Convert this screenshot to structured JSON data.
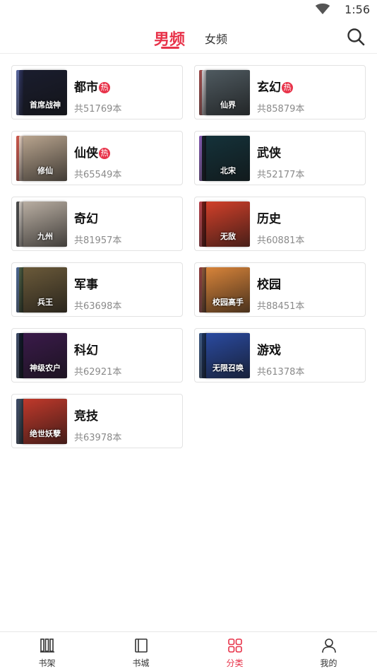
{
  "status_bar": {
    "time": "1:56",
    "wifi_icon": "wifi-icon"
  },
  "tabs": {
    "male": "男频",
    "female": "女频",
    "search_icon": "search-icon"
  },
  "hot_badge": "热",
  "categories": [
    {
      "name": "都市",
      "hot": true,
      "count": "共51769本",
      "cover_text": "首席战神",
      "colors": [
        "#3a4a8a",
        "#2a2f55",
        "#1a1d2e"
      ]
    },
    {
      "name": "玄幻",
      "hot": true,
      "count": "共85879本",
      "cover_text": "仙界",
      "colors": [
        "#8a2a2a",
        "#cfd4d8",
        "#4f5a60"
      ]
    },
    {
      "name": "仙侠",
      "hot": true,
      "count": "共65549本",
      "cover_text": "修仙",
      "colors": [
        "#c0392b",
        "#e6d8c8",
        "#b8a48e"
      ]
    },
    {
      "name": "武侠",
      "hot": false,
      "count": "共52177本",
      "cover_text": "北宋",
      "colors": [
        "#6b3aa0",
        "#0d1a1e",
        "#14323a"
      ]
    },
    {
      "name": "奇幻",
      "hot": false,
      "count": "共81957本",
      "cover_text": "九州",
      "colors": [
        "#2a2a2a",
        "#d8d0c8",
        "#b9aea2"
      ]
    },
    {
      "name": "历史",
      "hot": false,
      "count": "共60881本",
      "cover_text": "无敌",
      "colors": [
        "#a81f2a",
        "#6a1a12",
        "#d1402a"
      ]
    },
    {
      "name": "军事",
      "hot": false,
      "count": "共63698本",
      "cover_text": "兵王",
      "colors": [
        "#2a4a7a",
        "#4a5a3a",
        "#6b5a3a"
      ]
    },
    {
      "name": "校园",
      "hot": false,
      "count": "共88451本",
      "cover_text": "校园高手",
      "colors": [
        "#7a1a1a",
        "#8a5a3a",
        "#d8843a"
      ]
    },
    {
      "name": "科幻",
      "hot": false,
      "count": "共62921本",
      "cover_text": "神级农户",
      "colors": [
        "#1a2a4a",
        "#0e1626",
        "#3a1a4a"
      ]
    },
    {
      "name": "游戏",
      "hot": false,
      "count": "共61378本",
      "cover_text": "无限召唤",
      "colors": [
        "#1a3a6a",
        "#1a2f55",
        "#2a4aa0"
      ]
    },
    {
      "name": "竞技",
      "hot": false,
      "count": "共63978本",
      "cover_text": "绝世妖孽",
      "colors": [
        "#1a2a4a",
        "#3a4a5a",
        "#c0392b"
      ]
    }
  ],
  "bottom_nav": [
    {
      "label": "书架",
      "icon": "bookshelf-icon",
      "active": false
    },
    {
      "label": "书城",
      "icon": "bookstore-icon",
      "active": false
    },
    {
      "label": "分类",
      "icon": "category-grid-icon",
      "active": true
    },
    {
      "label": "我的",
      "icon": "profile-icon",
      "active": false
    }
  ],
  "accent_color": "#e8334a"
}
